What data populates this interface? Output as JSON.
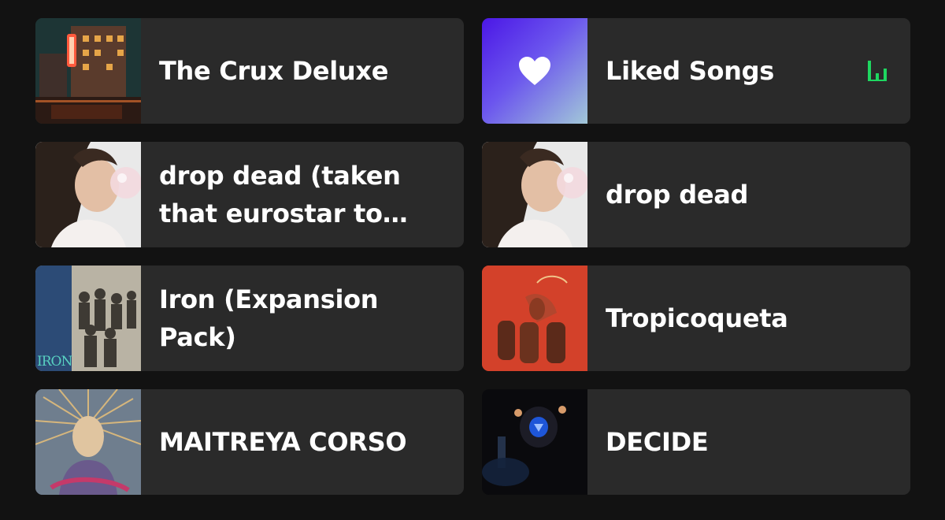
{
  "cards": [
    {
      "title": "The Crux Deluxe",
      "art": "city-night-cover"
    },
    {
      "title": "Liked Songs",
      "art": "heart-gradient-cover",
      "playing": true
    },
    {
      "title": "drop dead (taken that eurostar to fr…",
      "art": "bubblegum-portrait-cover"
    },
    {
      "title": "drop dead",
      "art": "bubblegum-portrait-cover"
    },
    {
      "title": "Iron (Expansion Pack)",
      "art": "band-photo-cover",
      "art_text": "IRON"
    },
    {
      "title": "Tropicoqueta",
      "art": "red-conga-cover"
    },
    {
      "title": "MAITREYA CORSO",
      "art": "painted-portrait-cover"
    },
    {
      "title": "DECIDE",
      "art": "eight-ball-cover"
    }
  ],
  "colors": {
    "background": "#121212",
    "card": "#2a2a2a",
    "text": "#ffffff",
    "accent": "#1ed760"
  },
  "icons": [
    "heart-icon",
    "now-playing-equalizer-icon"
  ]
}
